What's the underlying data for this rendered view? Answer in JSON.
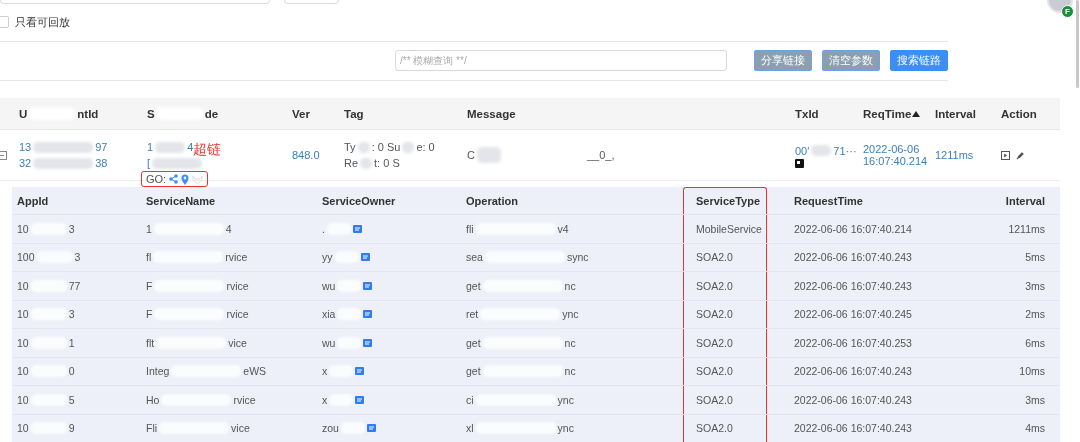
{
  "filters": {
    "checkbox": {
      "label": "只看可回放",
      "checked": false
    },
    "search": {
      "placeholder": "/** 模糊查询 **/"
    },
    "buttons": [
      {
        "label": "分享链接",
        "kind": "secondary"
      },
      {
        "label": "清空参数",
        "kind": "secondary"
      },
      {
        "label": "搜索链路",
        "kind": "primary"
      }
    ]
  },
  "avatar": {
    "badge": "F"
  },
  "trace_table": {
    "columns": [
      {
        "parts": [
          "U",
          "ntId"
        ],
        "sorted": false
      },
      {
        "parts": [
          "S",
          "de"
        ],
        "sorted": false
      },
      {
        "parts": [
          "Ver"
        ],
        "sorted": false
      },
      {
        "parts": [
          "Tag"
        ],
        "sorted": false
      },
      {
        "parts": [
          "Message"
        ],
        "sorted": false
      },
      {
        "parts": [
          "TxId"
        ],
        "sorted": false
      },
      {
        "parts": [
          "ReqTime"
        ],
        "sorted": true
      },
      {
        "parts": [
          "Interval"
        ],
        "sorted": false
      },
      {
        "parts": [
          "Action"
        ],
        "sorted": false
      }
    ],
    "rows": [
      {
        "expanded": true,
        "user_id": [
          [
            "13",
            "97"
          ],
          [
            "32",
            "38"
          ]
        ],
        "service_code": [
          [
            "1",
            "4"
          ],
          [
            "["
          ]
        ],
        "go": {
          "label": "GO:",
          "highlighted": true,
          "annotation": "超链"
        },
        "ver": "848.0",
        "tag": [
          [
            "Ty",
            ": 0 Su",
            "e: 0"
          ],
          [
            "Re",
            "t: 0 S"
          ]
        ],
        "message": [
          "C",
          "__0_,"
        ],
        "txid": [
          "00'",
          "71···"
        ],
        "req_time": [
          "2022-06-06",
          "16:07:40.214"
        ],
        "interval": "1211ms"
      }
    ]
  },
  "span_table": {
    "columns": [
      {
        "label": "AppId",
        "highlighted": false
      },
      {
        "label": "ServiceName",
        "highlighted": false
      },
      {
        "label": "ServiceOwner",
        "highlighted": false
      },
      {
        "label": "Operation",
        "highlighted": false
      },
      {
        "label": "ServiceType",
        "highlighted": true
      },
      {
        "label": "RequestTime",
        "highlighted": false
      },
      {
        "label": "Interval",
        "highlighted": false
      }
    ],
    "rows": [
      {
        "app_id": [
          "10",
          "3"
        ],
        "service_name": [
          "1",
          "4"
        ],
        "owner": [
          "."
        ],
        "operation": [
          "fli",
          "v4"
        ],
        "service_type": "MobileService",
        "request_time": "2022-06-06 16:07:40.214",
        "interval": "1211ms"
      },
      {
        "app_id": [
          "100",
          "3"
        ],
        "service_name": [
          "fl",
          "rvice"
        ],
        "owner": [
          "yy"
        ],
        "operation": [
          "sea",
          "sync"
        ],
        "service_type": "SOA2.0",
        "request_time": "2022-06-06 16:07:40.243",
        "interval": "5ms"
      },
      {
        "app_id": [
          "10",
          "77"
        ],
        "service_name": [
          "F",
          "rvice"
        ],
        "owner": [
          "wu"
        ],
        "operation": [
          "get",
          "nc"
        ],
        "service_type": "SOA2.0",
        "request_time": "2022-06-06 16:07:40.243",
        "interval": "3ms"
      },
      {
        "app_id": [
          "10",
          "3"
        ],
        "service_name": [
          "F",
          "rvice"
        ],
        "owner": [
          "xia"
        ],
        "operation": [
          "ret",
          "ync"
        ],
        "service_type": "SOA2.0",
        "request_time": "2022-06-06 16:07:40.245",
        "interval": "2ms"
      },
      {
        "app_id": [
          "10",
          "1"
        ],
        "service_name": [
          "flt",
          "vice"
        ],
        "owner": [
          "wu"
        ],
        "operation": [
          "get",
          "nc"
        ],
        "service_type": "SOA2.0",
        "request_time": "2022-06-06 16:07:40.253",
        "interval": "6ms"
      },
      {
        "app_id": [
          "10",
          "0"
        ],
        "service_name": [
          "Integ",
          "eWS"
        ],
        "owner": [
          "x"
        ],
        "operation": [
          "get",
          "nc"
        ],
        "service_type": "SOA2.0",
        "request_time": "2022-06-06 16:07:40.243",
        "interval": "10ms"
      },
      {
        "app_id": [
          "10",
          "5"
        ],
        "service_name": [
          "Ho",
          "rvice"
        ],
        "owner": [
          "x"
        ],
        "operation": [
          "ci",
          "ync"
        ],
        "service_type": "SOA2.0",
        "request_time": "2022-06-06 16:07:40.243",
        "interval": "3ms"
      },
      {
        "app_id": [
          "10",
          "9"
        ],
        "service_name": [
          "Fli",
          "vice"
        ],
        "owner": [
          "zou"
        ],
        "operation": [
          "xl",
          "ync"
        ],
        "service_type": "SOA2.0",
        "request_time": "2022-06-06 16:07:40.243",
        "interval": "4ms"
      }
    ]
  }
}
